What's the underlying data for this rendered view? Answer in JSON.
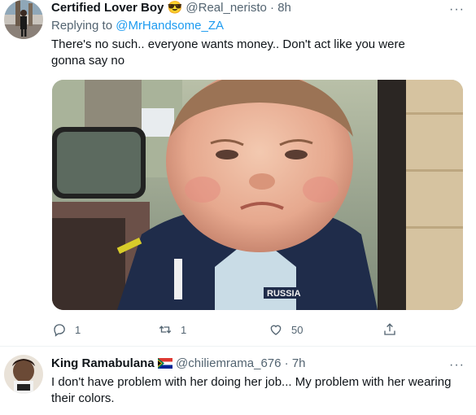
{
  "tweet1": {
    "display_name": "Certified Lover Boy",
    "emoji": "😎",
    "handle": "@Real_neristo",
    "separator": "·",
    "time": "8h",
    "replying_prefix": "Replying to",
    "replying_to": "@MrHandsome_ZA",
    "text": "There's no such.. everyone wants money.. Don't act like you were gonna say no",
    "media_badge": "RUSSIA",
    "replies": "1",
    "retweets": "1",
    "likes": "50"
  },
  "tweet2": {
    "display_name": "King Ramabulana",
    "flag": "south-africa-flag",
    "handle": "@chiliemrama_676",
    "separator": "·",
    "time": "7h",
    "text": "I don't have problem with her doing her job... My problem with her wearing their colors."
  },
  "colors": {
    "accent": "#1d9bf0",
    "muted": "#536471",
    "text": "#0f1419"
  }
}
